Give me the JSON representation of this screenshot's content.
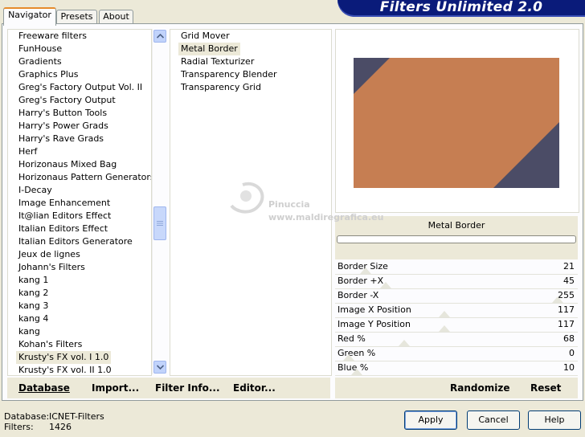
{
  "app": {
    "title": "Filters Unlimited 2.0"
  },
  "tabs": [
    {
      "label": "Navigator"
    },
    {
      "label": "Presets"
    },
    {
      "label": "About"
    }
  ],
  "categories": [
    "Freeware filters",
    "FunHouse",
    "Gradients",
    "Graphics Plus",
    "Greg's Factory Output Vol. II",
    "Greg's Factory Output",
    "Harry's Button Tools",
    "Harry's Power Grads",
    "Harry's Rave Grads",
    "Herf",
    "Horizonaus Mixed Bag",
    "Horizonaus Pattern Generators",
    "I-Decay",
    "Image Enhancement",
    "It@lian Editors Effect",
    "Italian Editors Effect",
    "Italian Editors Generatore",
    "Jeux de lignes",
    "Johann's Filters",
    "kang 1",
    "kang 2",
    "kang 3",
    "kang 4",
    "kang",
    "Kohan's Filters",
    "Krusty's FX vol. I 1.0",
    "Krusty's FX vol. II 1.0"
  ],
  "filters": [
    "Grid Mover",
    "Metal Border",
    "Radial Texturizer",
    "Transparency Blender",
    "Transparency Grid"
  ],
  "left_bar": {
    "database": "Database",
    "import": "Import...",
    "filter_info": "Filter Info...",
    "editor": "Editor..."
  },
  "preview": {
    "colors": {
      "tan": "#c67e52",
      "slate": "#4b4c66"
    }
  },
  "filter_name": "Metal Border",
  "progress": 0,
  "sliders": [
    {
      "label": "Border Size",
      "value": "21",
      "fraction": 0.082
    },
    {
      "label": "Border +X",
      "value": "45",
      "fraction": 0.176
    },
    {
      "label": "Border -X",
      "value": "255",
      "fraction": 1.0
    },
    {
      "label": "Image X Position",
      "value": "117",
      "fraction": 0.459
    },
    {
      "label": "Image Y Position",
      "value": "117",
      "fraction": 0.459
    },
    {
      "label": "Red %",
      "value": "68",
      "fraction": 0.267
    },
    {
      "label": "Green %",
      "value": "0",
      "fraction": 0.0
    },
    {
      "label": "Blue %",
      "value": "10",
      "fraction": 0.039
    }
  ],
  "right_bar": {
    "randomize": "Randomize",
    "reset": "Reset"
  },
  "status": {
    "database_label": "Database:",
    "database_value": "ICNET-Filters",
    "filters_label": "Filters:",
    "filters_value": "1426"
  },
  "buttons": {
    "apply": "Apply",
    "cancel": "Cancel",
    "help": "Help"
  },
  "watermark": {
    "name": "Pinuccia",
    "site": "www.maldiregrafica.eu"
  },
  "icons": {
    "scroll_up": "up-arrow-icon",
    "scroll_down": "down-arrow-icon",
    "thumb_grip": "grip-icon"
  }
}
